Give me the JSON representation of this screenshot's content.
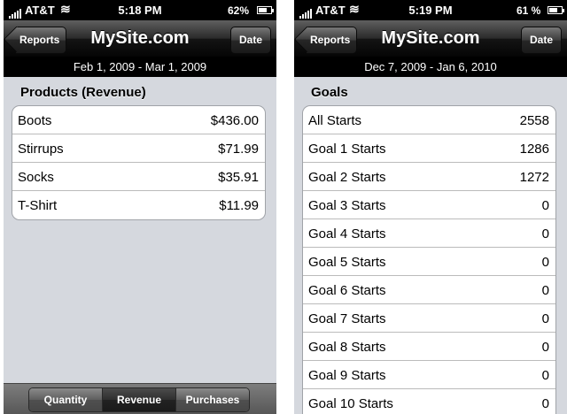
{
  "left": {
    "status": {
      "carrier": "AT&T",
      "time": "5:18 PM",
      "battery_pct": "62%",
      "battery_level": 0.62
    },
    "nav": {
      "back_label": "Reports",
      "title": "MySite.com",
      "date_button": "Date"
    },
    "date_range": "Feb 1, 2009 - Mar 1, 2009",
    "section_title": "Products (Revenue)",
    "rows": [
      {
        "label": "Boots",
        "value": "$436.00"
      },
      {
        "label": "Stirrups",
        "value": "$71.99"
      },
      {
        "label": "Socks",
        "value": "$35.91"
      },
      {
        "label": "T-Shirt",
        "value": "$11.99"
      }
    ],
    "segments": [
      "Quantity",
      "Revenue",
      "Purchases"
    ],
    "selected_segment": "Revenue"
  },
  "right": {
    "status": {
      "carrier": "AT&T",
      "time": "5:19 PM",
      "battery_pct": "61 %",
      "battery_level": 0.61
    },
    "nav": {
      "back_label": "Reports",
      "title": "MySite.com",
      "date_button": "Date"
    },
    "date_range": "Dec 7, 2009 - Jan 6, 2010",
    "section_title": "Goals",
    "rows": [
      {
        "label": "All Starts",
        "value": "2558"
      },
      {
        "label": "Goal 1 Starts",
        "value": "1286"
      },
      {
        "label": "Goal 2 Starts",
        "value": "1272"
      },
      {
        "label": "Goal 3 Starts",
        "value": "0"
      },
      {
        "label": "Goal 4 Starts",
        "value": "0"
      },
      {
        "label": "Goal 5 Starts",
        "value": "0"
      },
      {
        "label": "Goal 6 Starts",
        "value": "0"
      },
      {
        "label": "Goal 7 Starts",
        "value": "0"
      },
      {
        "label": "Goal 8 Starts",
        "value": "0"
      },
      {
        "label": "Goal 9 Starts",
        "value": "0"
      },
      {
        "label": "Goal 10 Starts",
        "value": "0"
      }
    ]
  },
  "icons": {
    "signal": "signal-bars-icon",
    "wifi": "wifi-icon",
    "battery": "battery-icon"
  }
}
